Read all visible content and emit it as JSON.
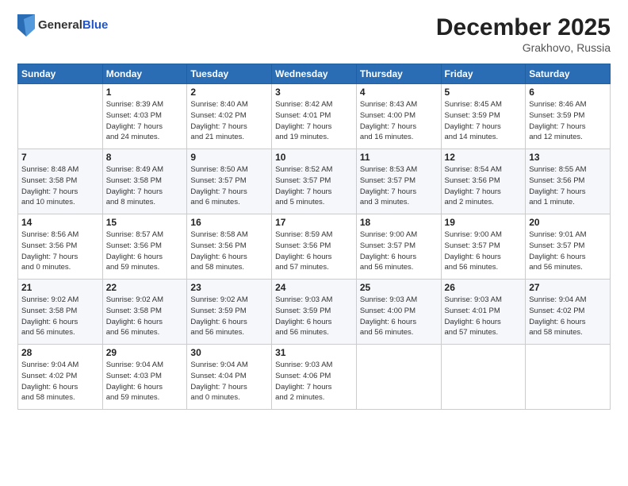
{
  "logo": {
    "general": "General",
    "blue": "Blue"
  },
  "header": {
    "month_year": "December 2025",
    "location": "Grakhovo, Russia"
  },
  "weekdays": [
    "Sunday",
    "Monday",
    "Tuesday",
    "Wednesday",
    "Thursday",
    "Friday",
    "Saturday"
  ],
  "weeks": [
    [
      {
        "day": "",
        "info": ""
      },
      {
        "day": "1",
        "info": "Sunrise: 8:39 AM\nSunset: 4:03 PM\nDaylight: 7 hours\nand 24 minutes."
      },
      {
        "day": "2",
        "info": "Sunrise: 8:40 AM\nSunset: 4:02 PM\nDaylight: 7 hours\nand 21 minutes."
      },
      {
        "day": "3",
        "info": "Sunrise: 8:42 AM\nSunset: 4:01 PM\nDaylight: 7 hours\nand 19 minutes."
      },
      {
        "day": "4",
        "info": "Sunrise: 8:43 AM\nSunset: 4:00 PM\nDaylight: 7 hours\nand 16 minutes."
      },
      {
        "day": "5",
        "info": "Sunrise: 8:45 AM\nSunset: 3:59 PM\nDaylight: 7 hours\nand 14 minutes."
      },
      {
        "day": "6",
        "info": "Sunrise: 8:46 AM\nSunset: 3:59 PM\nDaylight: 7 hours\nand 12 minutes."
      }
    ],
    [
      {
        "day": "7",
        "info": "Sunrise: 8:48 AM\nSunset: 3:58 PM\nDaylight: 7 hours\nand 10 minutes."
      },
      {
        "day": "8",
        "info": "Sunrise: 8:49 AM\nSunset: 3:58 PM\nDaylight: 7 hours\nand 8 minutes."
      },
      {
        "day": "9",
        "info": "Sunrise: 8:50 AM\nSunset: 3:57 PM\nDaylight: 7 hours\nand 6 minutes."
      },
      {
        "day": "10",
        "info": "Sunrise: 8:52 AM\nSunset: 3:57 PM\nDaylight: 7 hours\nand 5 minutes."
      },
      {
        "day": "11",
        "info": "Sunrise: 8:53 AM\nSunset: 3:57 PM\nDaylight: 7 hours\nand 3 minutes."
      },
      {
        "day": "12",
        "info": "Sunrise: 8:54 AM\nSunset: 3:56 PM\nDaylight: 7 hours\nand 2 minutes."
      },
      {
        "day": "13",
        "info": "Sunrise: 8:55 AM\nSunset: 3:56 PM\nDaylight: 7 hours\nand 1 minute."
      }
    ],
    [
      {
        "day": "14",
        "info": "Sunrise: 8:56 AM\nSunset: 3:56 PM\nDaylight: 7 hours\nand 0 minutes."
      },
      {
        "day": "15",
        "info": "Sunrise: 8:57 AM\nSunset: 3:56 PM\nDaylight: 6 hours\nand 59 minutes."
      },
      {
        "day": "16",
        "info": "Sunrise: 8:58 AM\nSunset: 3:56 PM\nDaylight: 6 hours\nand 58 minutes."
      },
      {
        "day": "17",
        "info": "Sunrise: 8:59 AM\nSunset: 3:56 PM\nDaylight: 6 hours\nand 57 minutes."
      },
      {
        "day": "18",
        "info": "Sunrise: 9:00 AM\nSunset: 3:57 PM\nDaylight: 6 hours\nand 56 minutes."
      },
      {
        "day": "19",
        "info": "Sunrise: 9:00 AM\nSunset: 3:57 PM\nDaylight: 6 hours\nand 56 minutes."
      },
      {
        "day": "20",
        "info": "Sunrise: 9:01 AM\nSunset: 3:57 PM\nDaylight: 6 hours\nand 56 minutes."
      }
    ],
    [
      {
        "day": "21",
        "info": "Sunrise: 9:02 AM\nSunset: 3:58 PM\nDaylight: 6 hours\nand 56 minutes."
      },
      {
        "day": "22",
        "info": "Sunrise: 9:02 AM\nSunset: 3:58 PM\nDaylight: 6 hours\nand 56 minutes."
      },
      {
        "day": "23",
        "info": "Sunrise: 9:02 AM\nSunset: 3:59 PM\nDaylight: 6 hours\nand 56 minutes."
      },
      {
        "day": "24",
        "info": "Sunrise: 9:03 AM\nSunset: 3:59 PM\nDaylight: 6 hours\nand 56 minutes."
      },
      {
        "day": "25",
        "info": "Sunrise: 9:03 AM\nSunset: 4:00 PM\nDaylight: 6 hours\nand 56 minutes."
      },
      {
        "day": "26",
        "info": "Sunrise: 9:03 AM\nSunset: 4:01 PM\nDaylight: 6 hours\nand 57 minutes."
      },
      {
        "day": "27",
        "info": "Sunrise: 9:04 AM\nSunset: 4:02 PM\nDaylight: 6 hours\nand 58 minutes."
      }
    ],
    [
      {
        "day": "28",
        "info": "Sunrise: 9:04 AM\nSunset: 4:02 PM\nDaylight: 6 hours\nand 58 minutes."
      },
      {
        "day": "29",
        "info": "Sunrise: 9:04 AM\nSunset: 4:03 PM\nDaylight: 6 hours\nand 59 minutes."
      },
      {
        "day": "30",
        "info": "Sunrise: 9:04 AM\nSunset: 4:04 PM\nDaylight: 7 hours\nand 0 minutes."
      },
      {
        "day": "31",
        "info": "Sunrise: 9:03 AM\nSunset: 4:06 PM\nDaylight: 7 hours\nand 2 minutes."
      },
      {
        "day": "",
        "info": ""
      },
      {
        "day": "",
        "info": ""
      },
      {
        "day": "",
        "info": ""
      }
    ]
  ]
}
